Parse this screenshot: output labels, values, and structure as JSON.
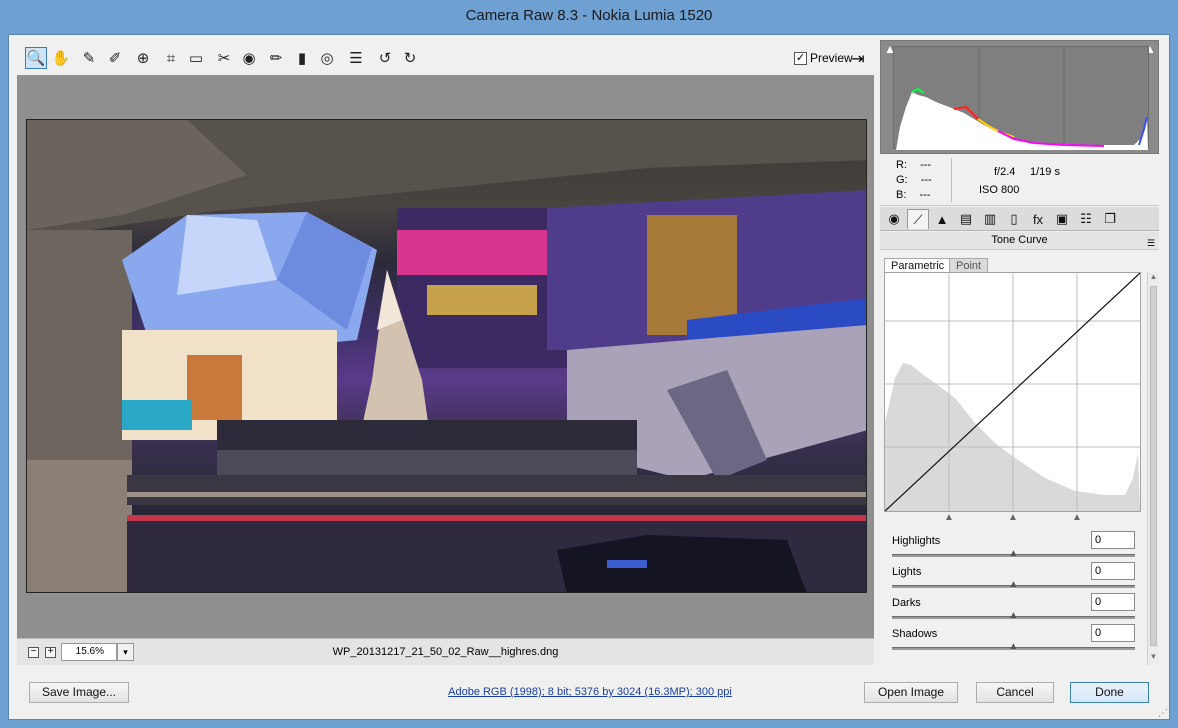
{
  "window": {
    "title": "Camera Raw 8.3  -  Nokia Lumia 1520"
  },
  "toolbar": {
    "tools": [
      {
        "name": "zoom-tool-icon",
        "glyph": "🔍"
      },
      {
        "name": "hand-tool-icon",
        "glyph": "✋"
      },
      {
        "name": "white-balance-tool-icon",
        "glyph": "✎"
      },
      {
        "name": "color-sampler-tool-icon",
        "glyph": "✐"
      },
      {
        "name": "targeted-adjustment-tool-icon",
        "glyph": "⊕"
      },
      {
        "name": "crop-tool-icon",
        "glyph": "⌗"
      },
      {
        "name": "straighten-tool-icon",
        "glyph": "▭"
      },
      {
        "name": "spot-removal-tool-icon",
        "glyph": "✂"
      },
      {
        "name": "red-eye-removal-icon",
        "glyph": "◉"
      },
      {
        "name": "adjustment-brush-icon",
        "glyph": "✏"
      },
      {
        "name": "graduated-filter-icon",
        "glyph": "▮"
      },
      {
        "name": "radial-filter-icon",
        "glyph": "◎"
      },
      {
        "name": "preferences-icon",
        "glyph": "☰"
      },
      {
        "name": "rotate-left-icon",
        "glyph": "↺"
      },
      {
        "name": "rotate-right-icon",
        "glyph": "↻"
      }
    ],
    "preview_label": "Preview",
    "preview_checked": "✓",
    "export_glyph": "⇥"
  },
  "bottombar": {
    "zoom_minus": "−",
    "zoom_plus": "+",
    "zoom_value": "15.6%",
    "zoom_dropdown": "▾",
    "filename": "WP_20131217_21_50_02_Raw__highres.dng"
  },
  "readout": {
    "r_label": "R:",
    "r_value": "---",
    "g_label": "G:",
    "g_value": "---",
    "b_label": "B:",
    "b_value": "---",
    "aperture": "f/2.4",
    "shutter": "1/19 s",
    "iso": "ISO 800"
  },
  "panel_tabs": [
    {
      "name": "basic-tab-icon",
      "glyph": "◉"
    },
    {
      "name": "tone-curve-tab-icon",
      "glyph": "⟋"
    },
    {
      "name": "detail-tab-icon",
      "glyph": "▲"
    },
    {
      "name": "hsl-tab-icon",
      "glyph": "▤"
    },
    {
      "name": "split-toning-tab-icon",
      "glyph": "▥"
    },
    {
      "name": "lens-corrections-tab-icon",
      "glyph": "▯"
    },
    {
      "name": "effects-tab-icon",
      "glyph": "fx"
    },
    {
      "name": "camera-calibration-tab-icon",
      "glyph": "▣"
    },
    {
      "name": "presets-tab-icon",
      "glyph": "☷"
    },
    {
      "name": "snapshots-tab-icon",
      "glyph": "❐"
    }
  ],
  "tone_curve": {
    "header": "Tone Curve",
    "menu_glyph": "☰",
    "subtab_parametric": "Parametric",
    "subtab_point": "Point",
    "sliders": [
      {
        "label": "Highlights",
        "value": "0",
        "level": 0.5
      },
      {
        "label": "Lights",
        "value": "0",
        "level": 0.5
      },
      {
        "label": "Darks",
        "value": "0",
        "level": 0.5
      },
      {
        "label": "Shadows",
        "value": "0",
        "level": 0.5
      }
    ]
  },
  "footer": {
    "save_label": "Save Image...",
    "workflow_link": "Adobe RGB (1998); 8 bit; 5376 by 3024 (16.3MP); 300 ppi",
    "open_label": "Open Image",
    "cancel_label": "Cancel",
    "done_label": "Done"
  },
  "colors": {
    "accent": "#3c7fb1",
    "titlebar": "#6fa0d2"
  }
}
